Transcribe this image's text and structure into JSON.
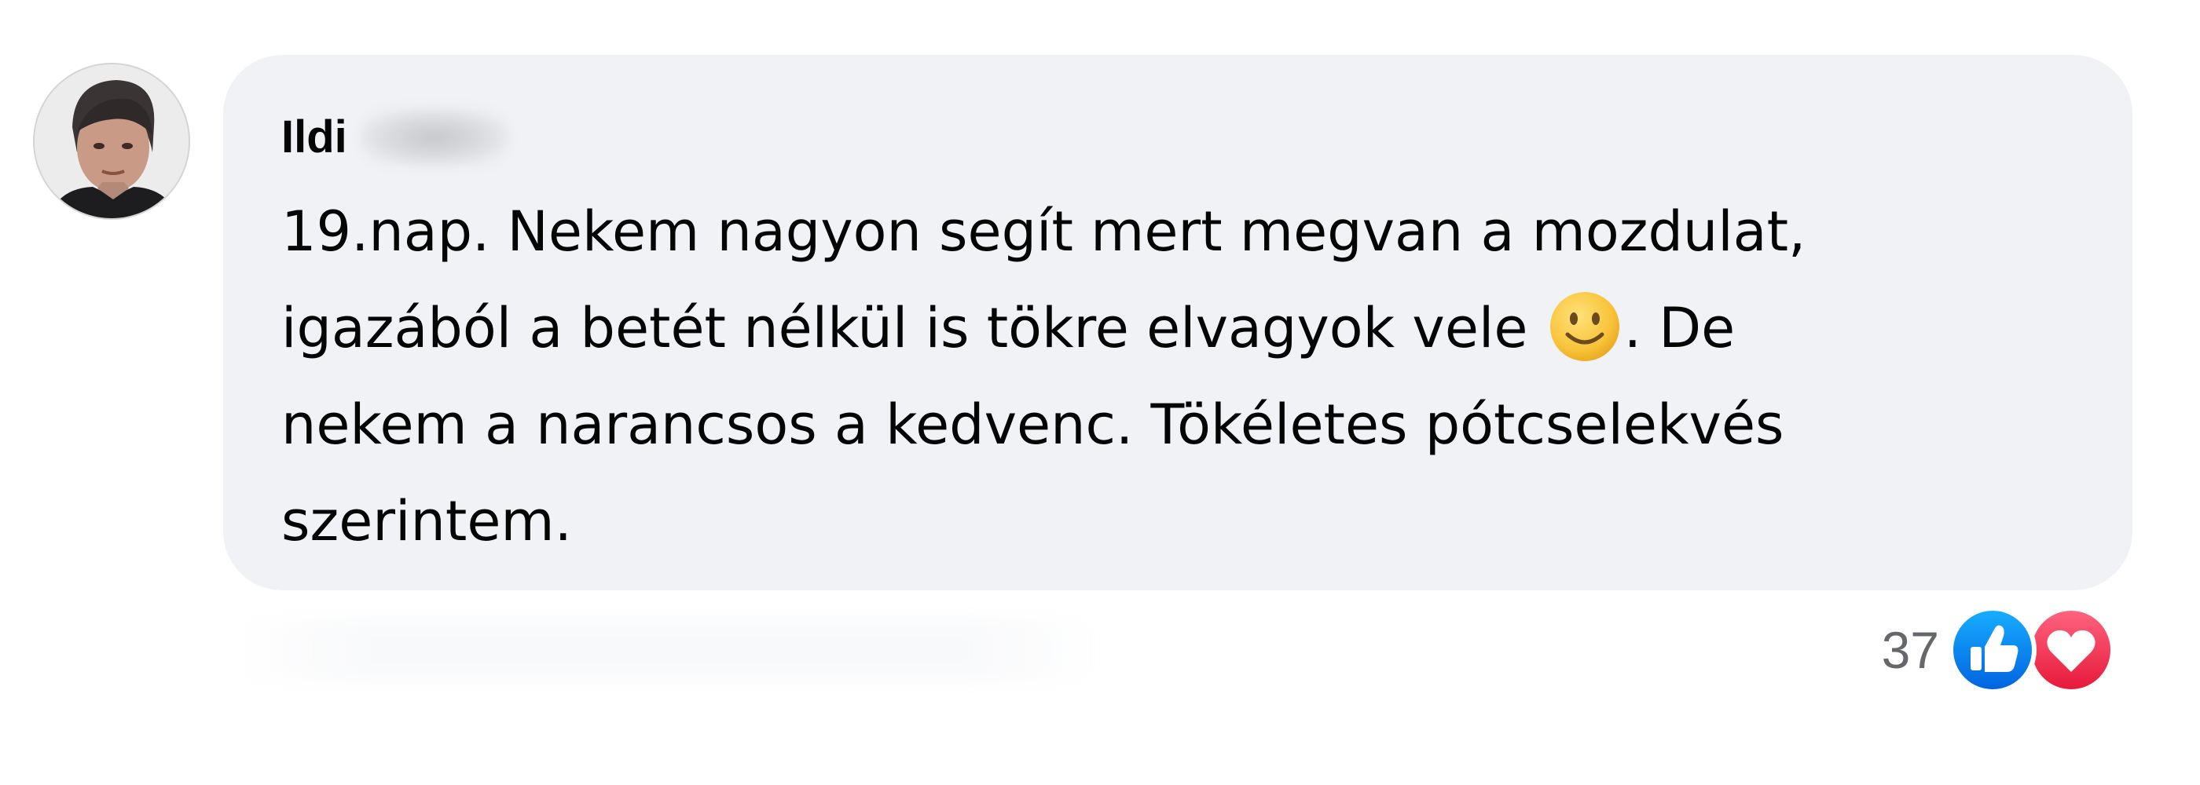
{
  "comment": {
    "author": {
      "name": "Ildi",
      "avatar_icon": "profile-photo"
    },
    "text_lines": [
      "19.nap. Nekem nagyon segít mert megvan a mozdulat,",
      "igazából a betét nélkül is tökre elvagyok vele",
      ". De",
      "nekem a narancsos a kedvenc. Tökéletes pótcselekvés",
      "szerintem."
    ],
    "emoji": "slightly-smiling-face",
    "reactions": {
      "count": "37",
      "icons": [
        "like-icon",
        "love-icon"
      ],
      "like_color": "#1877f2",
      "love_color": "#f33e58"
    }
  },
  "colors": {
    "bubble_bg": "#f0f2f5",
    "text": "#050505",
    "secondary_text": "#65676b"
  }
}
